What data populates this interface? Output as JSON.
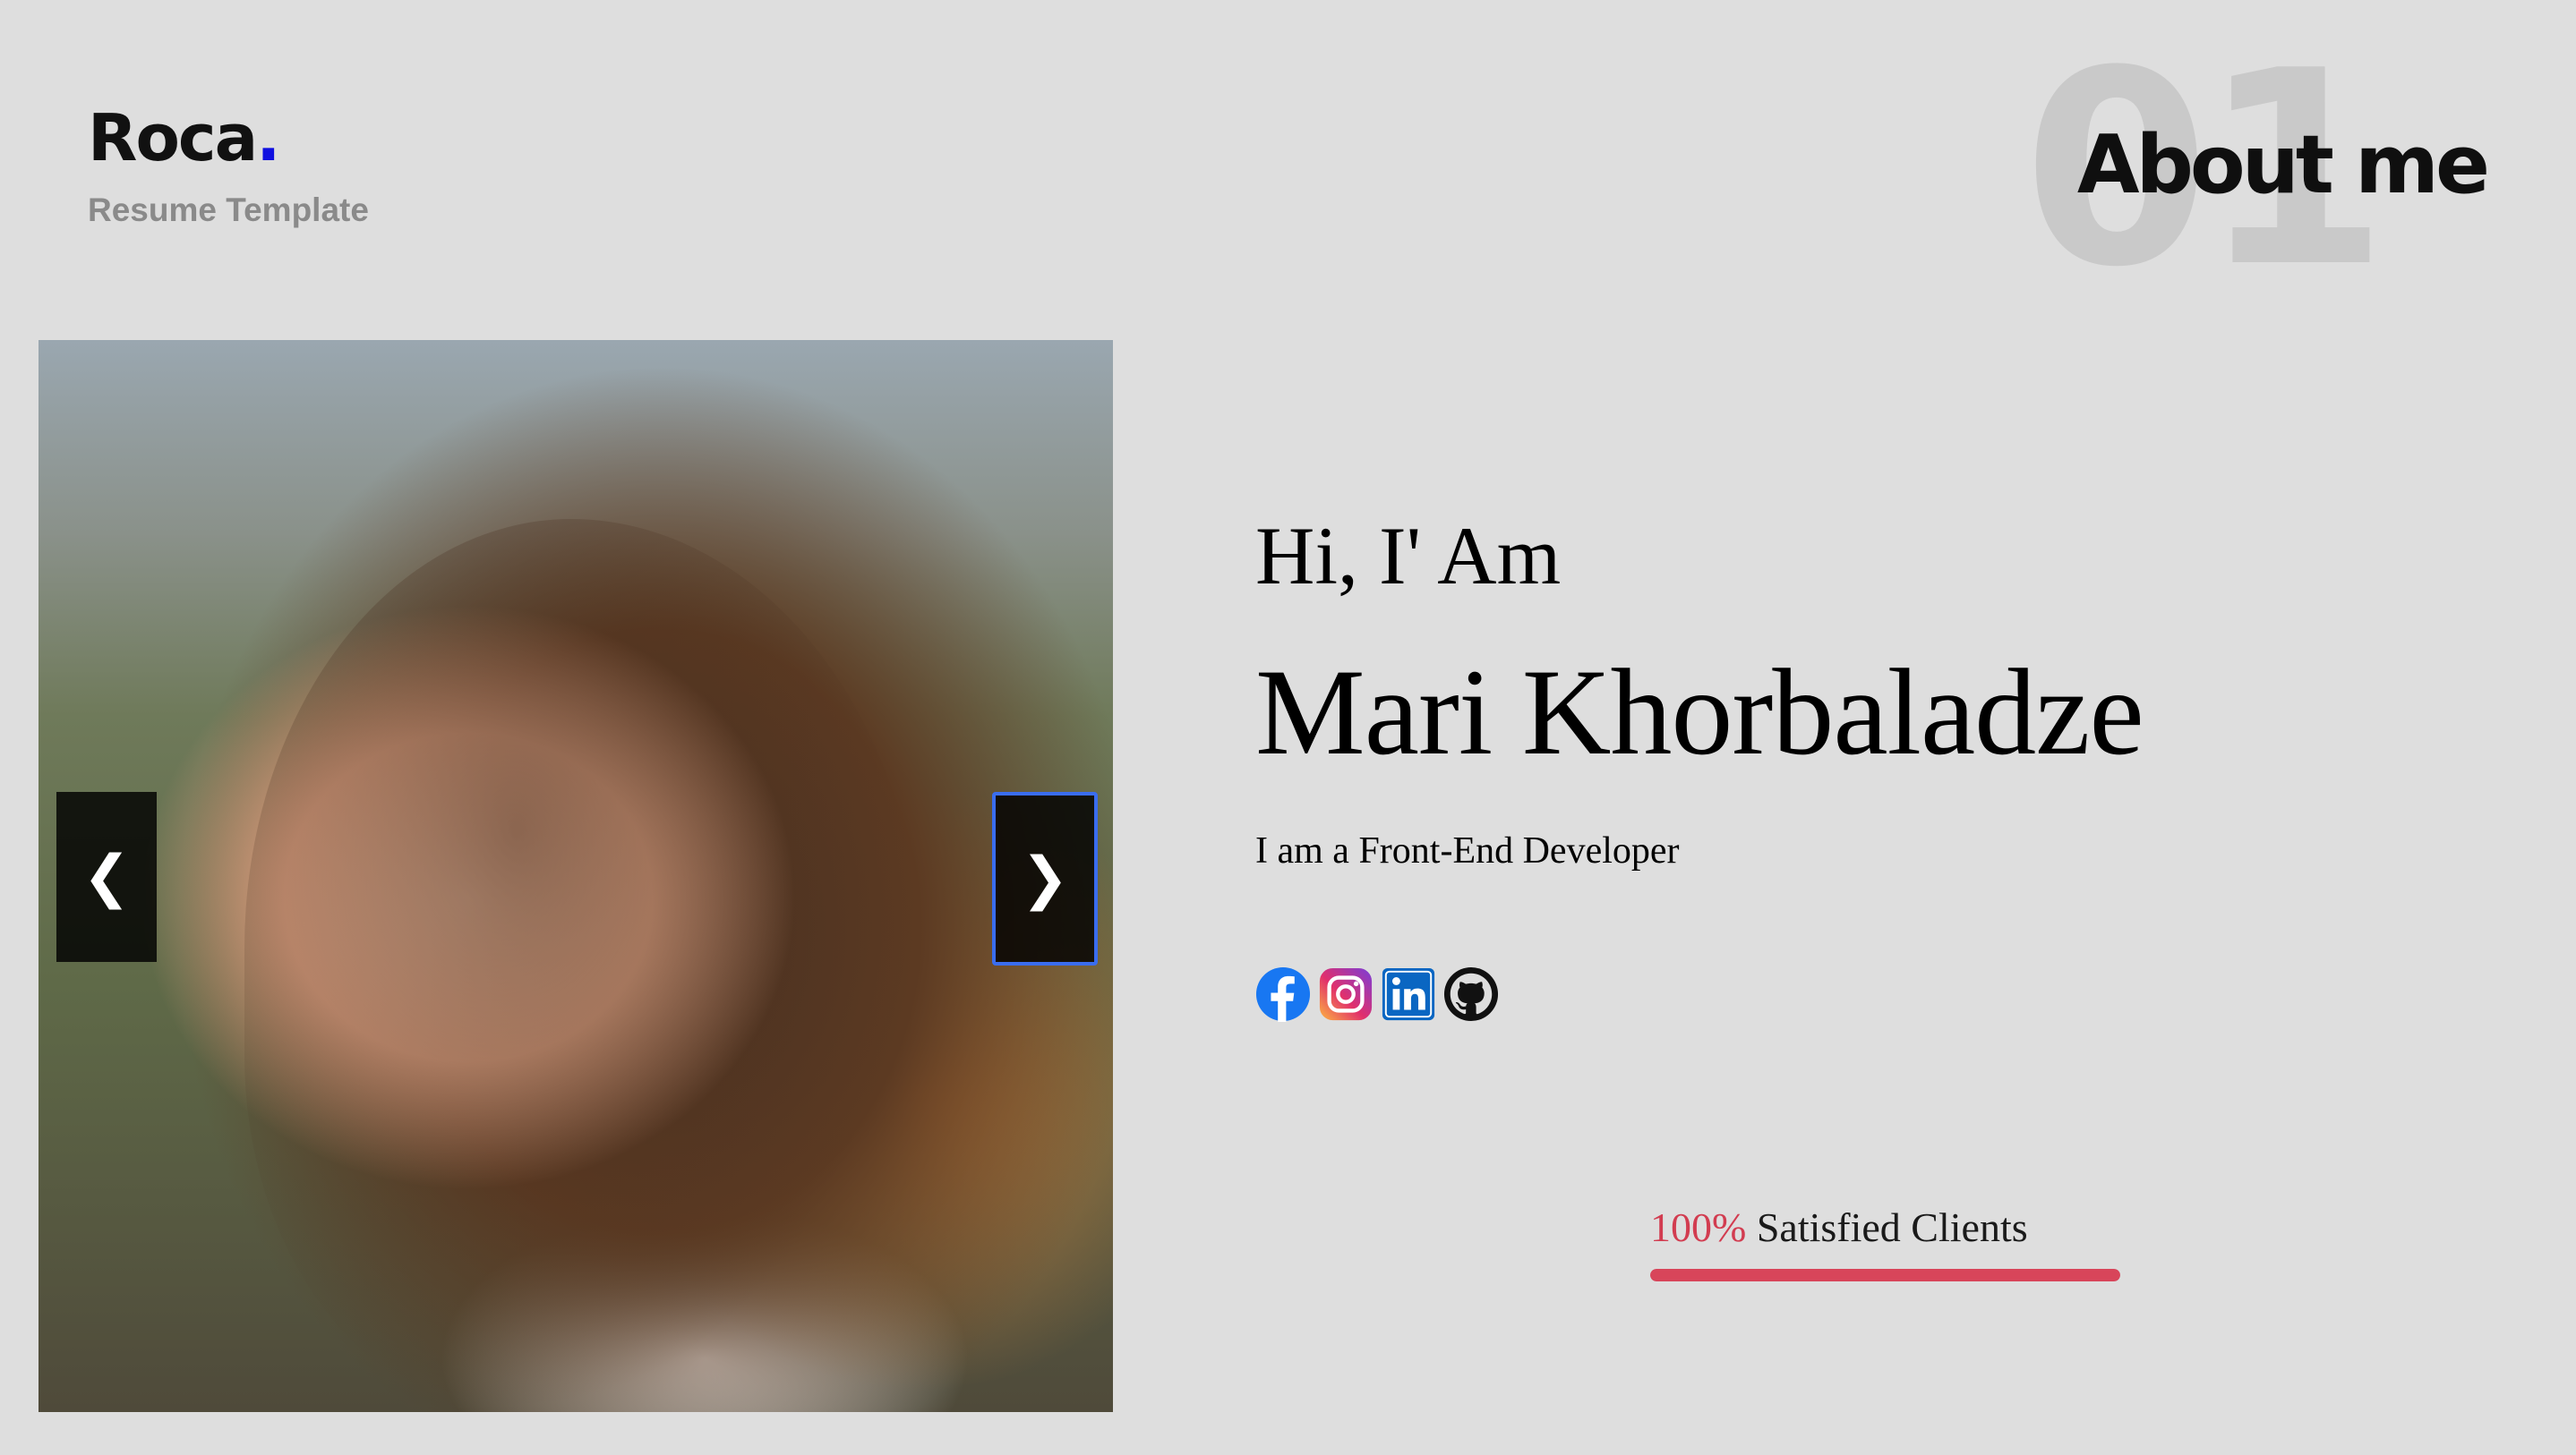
{
  "brand": {
    "name": "Roca",
    "dot": ".",
    "subtitle": "Resume Template",
    "dot_color": "#1010e0"
  },
  "section": {
    "number": "01",
    "title": "About me"
  },
  "carousel": {
    "prev_label": "❮",
    "next_label": "❯"
  },
  "intro": {
    "greeting": "Hi, I' Am",
    "name": "Mari Khorbaladze",
    "role": "I am a Front-End Developer"
  },
  "socials": [
    {
      "icon": "facebook-icon",
      "color": "#1877f2"
    },
    {
      "icon": "instagram-icon",
      "color": "#d6249f"
    },
    {
      "icon": "linkedin-icon",
      "color": "#0a66c2"
    },
    {
      "icon": "github-icon",
      "color": "#111111"
    }
  ],
  "stats": {
    "value": "100%",
    "label": "Satisfied Clients",
    "fill_percent": 100,
    "accent_color": "#d8455a"
  }
}
